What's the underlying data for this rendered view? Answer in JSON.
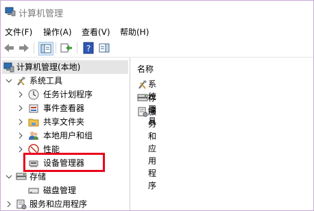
{
  "window": {
    "title": "计算机管理"
  },
  "menu": [
    {
      "label": "文件(F)"
    },
    {
      "label": "操作(A)"
    },
    {
      "label": "查看(V)"
    },
    {
      "label": "帮助(H)"
    }
  ],
  "tree": {
    "root": "计算机管理(本地)",
    "system_tools": "系统工具",
    "task_scheduler": "任务计划程序",
    "event_viewer": "事件查看器",
    "shared_folders": "共享文件夹",
    "local_users": "本地用户和组",
    "performance": "性能",
    "device_manager": "设备管理器",
    "storage": "存储",
    "disk_management": "磁盘管理",
    "services_apps": "服务和应用程序"
  },
  "right_pane": {
    "column_header": "名称",
    "items": [
      {
        "label": "系统工具",
        "icon": "tools-icon"
      },
      {
        "label": "存储",
        "icon": "storage-icon"
      },
      {
        "label": "服务和应用程序",
        "icon": "services-icon"
      }
    ]
  },
  "colors": {
    "highlight_border": "#e8001a",
    "selection": "#e5e5e5"
  }
}
